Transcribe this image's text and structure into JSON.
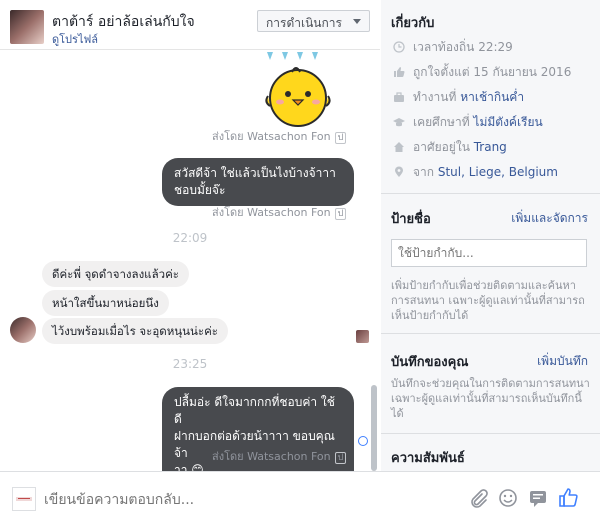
{
  "header": {
    "title": "ตาต้าร์ อย่าล้อเล่นกับใจ",
    "subtitle": "ดูโปรไฟล์",
    "actions_label": "การดำเนินการ"
  },
  "messages": {
    "sent_by": "ส่งโดย Watsachon Fon",
    "msg_out_1": [
      "สวัสดีจ้า ใช่แล้วเป็นไงบ้างจ้าาา",
      "ชอบมั้ยจ๊ะ"
    ],
    "time_1": "22:09",
    "msg_in_1": "ดีค่ะพี่ จุดดำจางลงแล้วค่ะ",
    "msg_in_2": "หน้าใสขึ้นมาหน่อยนึง",
    "msg_in_3": "ไว้งบพร้อมเมื่อไร จะอุดหนุนน่ะค่ะ",
    "time_2": "23:25",
    "msg_out_2": [
      "ปลื้มอ่ะ ดีใจมากกกที่ชอบค่า  ใช้ดี",
      "ฝากบอกต่อด้วยน้าาาา ขอบคุณจ้า",
      "าา 😊"
    ],
    "seen_mark": "ป"
  },
  "composer": {
    "placeholder": "เขียนข้อความตอบกลับ...",
    "icons": [
      "attach-icon",
      "emoji-icon",
      "sticker-icon",
      "like-icon"
    ]
  },
  "about": {
    "title": "เกี่ยวกับ",
    "local_time_label": "เวลาท้องถิ่น 22:29",
    "liked_since": "ถูกใจตั้งแต่ 15 กันยายน 2016",
    "work_prefix": "ทำงานที่ ",
    "work_link": "หาเช้ากินค่ำ",
    "study_prefix": "เคยศึกษาที่ ",
    "study_link": "ไม่มีตังค์เรียน",
    "lives_prefix": "อาศัยอยู่ใน ",
    "lives_link": "Trang",
    "from_prefix": "จาก ",
    "from_link": "Stul, Liege, Belgium"
  },
  "tags": {
    "title": "ป้ายชื่อ",
    "manage_link": "เพิ่มและจัดการ",
    "input_placeholder": "ใช้ป้ายกำกับ...",
    "note": "เพิ่มป้ายกำกับเพื่อช่วยติดตามและค้นหาการสนทนา เฉพาะผู้ดูแลเท่านั้นที่สามารถเห็นป้ายกำกับได้"
  },
  "notes": {
    "title": "บันทึกของคุณ",
    "add_link": "เพิ่มบันทึก",
    "note": "บันทึกจะช่วยคุณในการติดตามการสนทนา เฉพาะผู้ดูแลเท่านั้นที่สามารถเห็นบันทึกนี้ได้"
  },
  "relationship": {
    "title": "ความสัมพันธ์"
  },
  "colors": {
    "link": "#385898",
    "bubble_out": "#484a4e",
    "bubble_in": "#f1f0f0",
    "panel_bg": "#f6f7f9",
    "like_blue": "#4080ff"
  }
}
